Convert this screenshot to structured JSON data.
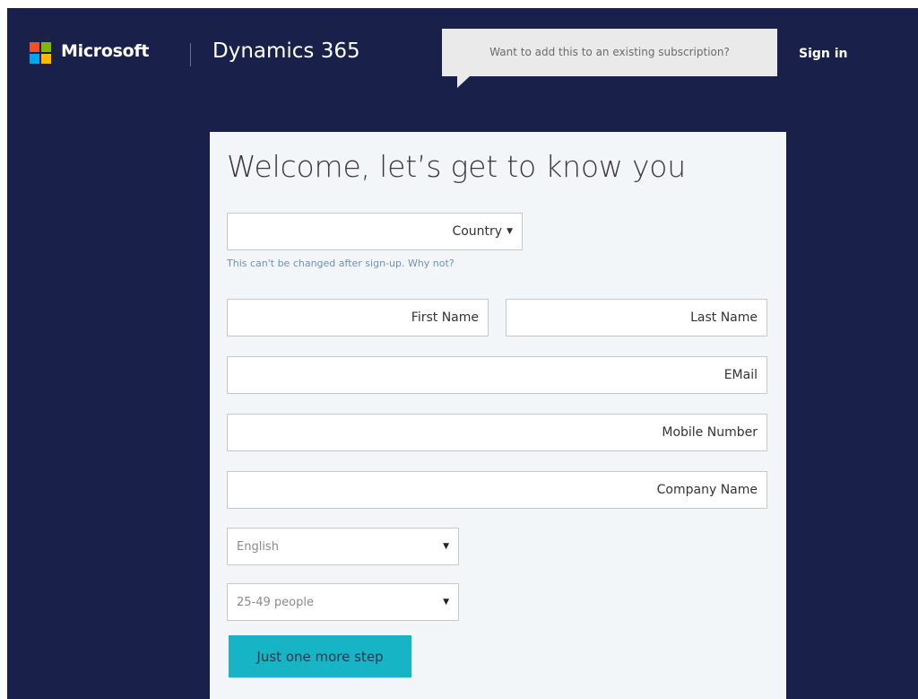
{
  "header": {
    "brand": "Microsoft",
    "product": "Dynamics 365",
    "existing_subscription_prompt": "Want to add this to an existing subscription?",
    "sign_in": "Sign in",
    "logo_colors": [
      "#f25022",
      "#7fba00",
      "#00a4ef",
      "#ffb900"
    ]
  },
  "form": {
    "title": "Welcome, let’s get to know you",
    "country_label": "Country",
    "country_hint": "This can't be changed after sign-up. Why not?",
    "first_name_placeholder": "First Name",
    "last_name_placeholder": "Last Name",
    "email_placeholder": "EMail",
    "mobile_placeholder": "Mobile Number",
    "company_placeholder": "Company Name",
    "language_selected": "English",
    "company_size_selected": "25-49 people",
    "submit_label": "Just one more step"
  },
  "colors": {
    "header_bg": "#19204a",
    "panel_bg": "#f3f6f9",
    "accent": "#17b4c6",
    "link": "#6f8fb4"
  }
}
